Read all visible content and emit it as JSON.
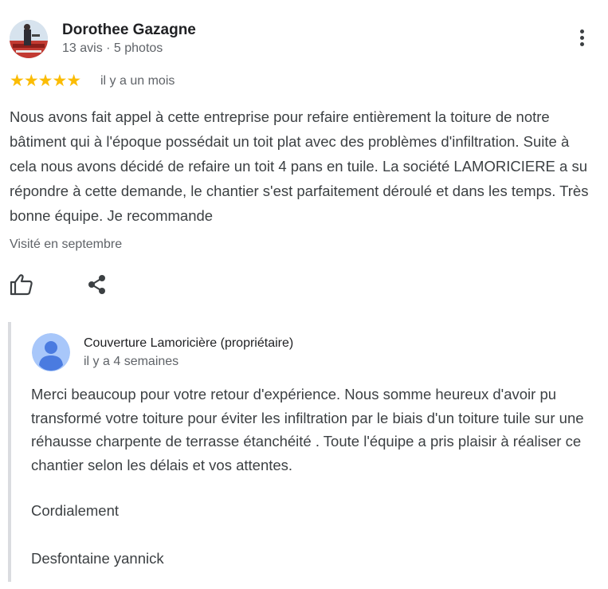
{
  "review": {
    "reviewer": {
      "name": "Dorothee Gazagne",
      "meta": "13 avis · 5 photos"
    },
    "rating": {
      "stars": 5,
      "max": 5,
      "display": "★★★★★"
    },
    "date": "il y a un mois",
    "text": "Nous avons fait appel à cette entreprise pour refaire entièrement la toiture de notre bâtiment qui à l'époque possédait un toit plat avec des problèmes d'infiltration. Suite à cela nous avons décidé de refaire un toit 4 pans en tuile. La société LAMORICIERE a su répondre à cette demande, le chantier s'est parfaitement déroulé et dans les temps. Très bonne équipe. Je recommande",
    "visited": "Visité en septembre",
    "actions": {
      "like_icon": "thumb-up-icon",
      "share_icon": "share-icon",
      "menu_icon": "more-vert-icon"
    }
  },
  "owner_response": {
    "name": "Couverture Lamoricière (propriétaire)",
    "date": "il y a 4 semaines",
    "text": "Merci beaucoup pour votre retour d'expérience. Nous somme heureux d'avoir pu transformé votre toiture pour éviter les infiltration par le biais d'un toiture tuile sur une réhausse charpente de terrasse étanchéité . Toute l'équipe a pris plaisir à réaliser ce chantier selon les délais et vos attentes.",
    "closing": "Cordialement",
    "signature": "Desfontaine yannick"
  },
  "colors": {
    "star": "#fbbc04",
    "text_primary": "#202124",
    "text_secondary": "#5f6368",
    "reply_border": "#dadce0",
    "owner_avatar_bg": "#a8c7fa",
    "owner_avatar_fg": "#4a7be0"
  }
}
